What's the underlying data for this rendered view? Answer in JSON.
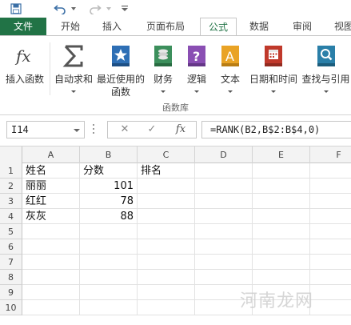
{
  "quick_access": {
    "icons": [
      "save-icon",
      "undo-icon",
      "redo-icon",
      "customize-icon"
    ]
  },
  "tabs": [
    {
      "label": "文件"
    },
    {
      "label": "开始"
    },
    {
      "label": "插入"
    },
    {
      "label": "页面布局"
    },
    {
      "label": "公式"
    },
    {
      "label": "数据"
    },
    {
      "label": "审阅"
    },
    {
      "label": "视图"
    }
  ],
  "ribbon": {
    "group_label": "函数库",
    "buttons": [
      {
        "label": "插入函数",
        "icon": "fx-icon"
      },
      {
        "label": "自动求和",
        "icon": "sigma-icon"
      },
      {
        "label": "最近使用的",
        "label2": "函数",
        "icon": "star-book-icon"
      },
      {
        "label": "财务",
        "icon": "coins-book-icon"
      },
      {
        "label": "逻辑",
        "icon": "question-book-icon"
      },
      {
        "label": "文本",
        "icon": "text-book-icon"
      },
      {
        "label": "日期和时间",
        "icon": "calendar-book-icon"
      },
      {
        "label": "查找与引用",
        "icon": "search-book-icon"
      }
    ],
    "accent_color": "#217346"
  },
  "formula_bar": {
    "name_box": "I14",
    "cancel_symbol": "✕",
    "enter_symbol": "✓",
    "fx_label": "fx",
    "formula": "=RANK(B2,B$2:B$4,0)"
  },
  "grid": {
    "columns": [
      "A",
      "B",
      "C",
      "D",
      "E",
      "F"
    ],
    "rows": [
      {
        "num": "1",
        "cells": [
          "姓名",
          "分数",
          "排名",
          "",
          "",
          ""
        ]
      },
      {
        "num": "2",
        "cells": [
          "丽丽",
          "101",
          "",
          "",
          "",
          ""
        ]
      },
      {
        "num": "3",
        "cells": [
          "红红",
          "78",
          "",
          "",
          "",
          ""
        ]
      },
      {
        "num": "4",
        "cells": [
          "灰灰",
          "88",
          "",
          "",
          "",
          ""
        ]
      },
      {
        "num": "5",
        "cells": [
          "",
          "",
          "",
          "",
          "",
          ""
        ]
      },
      {
        "num": "6",
        "cells": [
          "",
          "",
          "",
          "",
          "",
          ""
        ]
      },
      {
        "num": "7",
        "cells": [
          "",
          "",
          "",
          "",
          "",
          ""
        ]
      },
      {
        "num": "8",
        "cells": [
          "",
          "",
          "",
          "",
          "",
          ""
        ]
      },
      {
        "num": "9",
        "cells": [
          "",
          "",
          "",
          "",
          "",
          ""
        ]
      },
      {
        "num": "10",
        "cells": [
          "",
          "",
          "",
          "",
          "",
          ""
        ]
      }
    ]
  },
  "watermark": "河南龙网"
}
